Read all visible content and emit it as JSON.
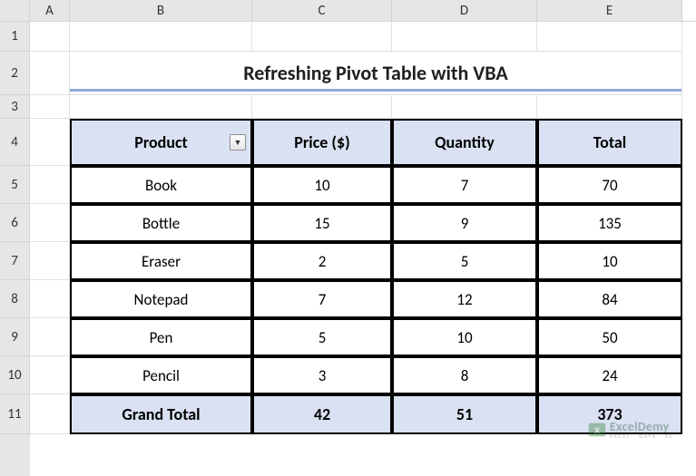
{
  "columns": [
    "A",
    "B",
    "C",
    "D",
    "E"
  ],
  "rows": [
    "1",
    "2",
    "3",
    "4",
    "5",
    "6",
    "7",
    "8",
    "9",
    "10",
    "11"
  ],
  "title": "Refreshing Pivot Table with VBA",
  "headers": {
    "product": "Product",
    "price": "Price ($)",
    "quantity": "Quantity",
    "total": "Total"
  },
  "data": [
    {
      "product": "Book",
      "price": "10",
      "quantity": "7",
      "total": "70"
    },
    {
      "product": "Bottle",
      "price": "15",
      "quantity": "9",
      "total": "135"
    },
    {
      "product": "Eraser",
      "price": "2",
      "quantity": "5",
      "total": "10"
    },
    {
      "product": "Notepad",
      "price": "7",
      "quantity": "12",
      "total": "84"
    },
    {
      "product": "Pen",
      "price": "5",
      "quantity": "10",
      "total": "50"
    },
    {
      "product": "Pencil",
      "price": "3",
      "quantity": "8",
      "total": "24"
    }
  ],
  "grand_total": {
    "label": "Grand Total",
    "price": "42",
    "quantity": "51",
    "total": "373"
  },
  "watermark": {
    "brand": "ExcelDemy",
    "tagline": "EXCEL · DATA · XL"
  },
  "colors": {
    "header_fill": "#d9e1f2",
    "title_underline": "#8ea9db"
  },
  "chart_data": {
    "type": "table",
    "title": "Refreshing Pivot Table with VBA",
    "columns": [
      "Product",
      "Price ($)",
      "Quantity",
      "Total"
    ],
    "rows": [
      [
        "Book",
        10,
        7,
        70
      ],
      [
        "Bottle",
        15,
        9,
        135
      ],
      [
        "Eraser",
        2,
        5,
        10
      ],
      [
        "Notepad",
        7,
        12,
        84
      ],
      [
        "Pen",
        5,
        10,
        50
      ],
      [
        "Pencil",
        3,
        8,
        24
      ]
    ],
    "totals": {
      "label": "Grand Total",
      "price": 42,
      "quantity": 51,
      "total": 373
    }
  }
}
